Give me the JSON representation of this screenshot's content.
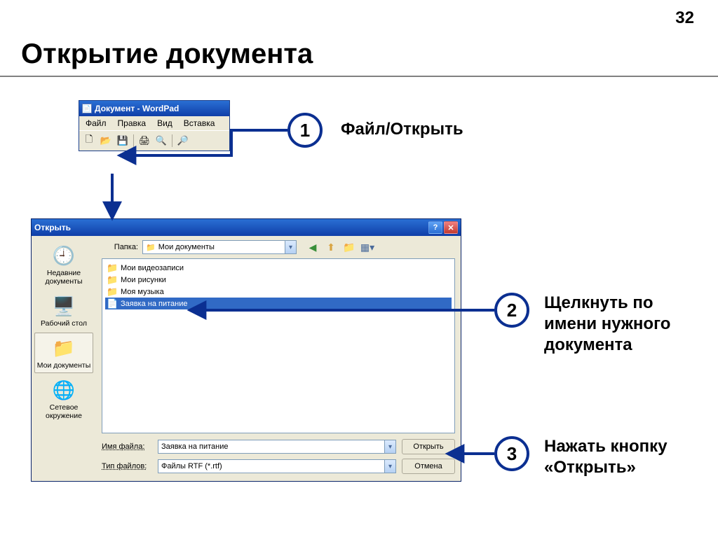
{
  "page": {
    "number": "32",
    "title": "Открытие документа"
  },
  "steps": {
    "s1": {
      "num": "1",
      "text": "Файл/Открыть"
    },
    "s2": {
      "num": "2",
      "text": "Щелкнуть по имени нужного документа"
    },
    "s3": {
      "num": "3",
      "text": "Нажать кнопку «Открыть»"
    }
  },
  "wordpad": {
    "title": "Документ - WordPad",
    "menu": {
      "file": "Файл",
      "edit": "Правка",
      "view": "Вид",
      "insert": "Вставка"
    }
  },
  "dialog": {
    "title": "Открыть",
    "lookin_label": "Папка:",
    "lookin_value": "Мои документы",
    "places": {
      "recent": "Недавние документы",
      "desktop": "Рабочий стол",
      "mydocs": "Мои документы",
      "network": "Сетевое окружение"
    },
    "files": {
      "f0": "Мои видеозаписи",
      "f1": "Мои рисунки",
      "f2": "Моя музыка",
      "f3": "Заявка на питание"
    },
    "filename_label": "Имя файла:",
    "filename_value": "Заявка на питание",
    "filetype_label": "Тип файлов:",
    "filetype_value": "Файлы RTF (*.rtf)",
    "btn_open": "Открыть",
    "btn_cancel": "Отмена"
  }
}
